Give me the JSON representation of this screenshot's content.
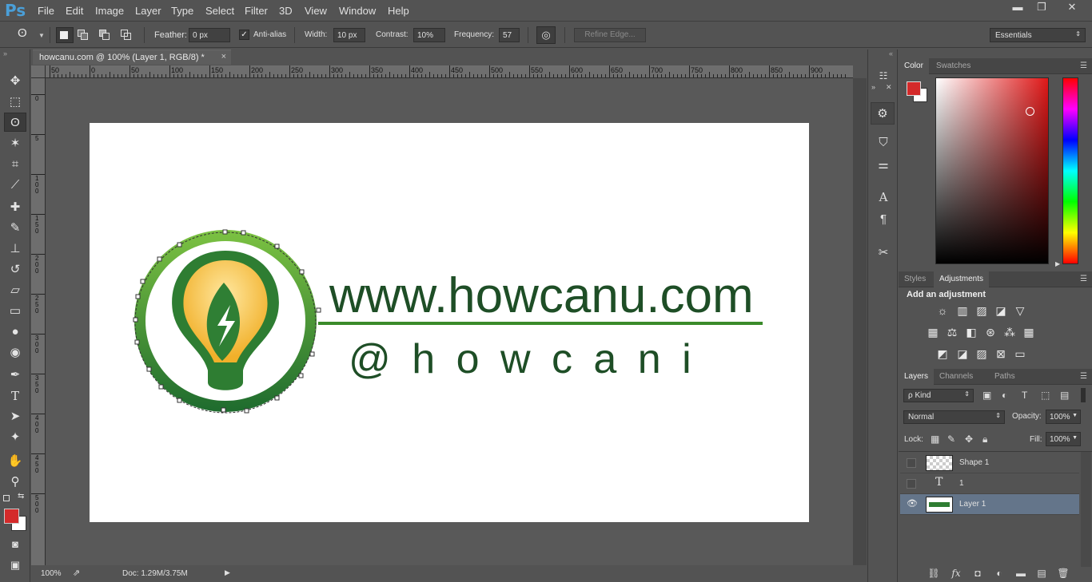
{
  "app": {
    "logo": "Ps"
  },
  "menu": [
    "File",
    "Edit",
    "Image",
    "Layer",
    "Type",
    "Select",
    "Filter",
    "3D",
    "View",
    "Window",
    "Help"
  ],
  "window_controls": {
    "minimize": "▬",
    "restore": "❐",
    "close": "✕"
  },
  "options": {
    "feather_label": "Feather:",
    "feather_value": "0 px",
    "antialias_label": "Anti-alias",
    "width_label": "Width:",
    "width_value": "10 px",
    "contrast_label": "Contrast:",
    "contrast_value": "10%",
    "frequency_label": "Frequency:",
    "frequency_value": "57",
    "refine_edge": "Refine Edge...",
    "workspace": "Essentials"
  },
  "document": {
    "tab_title": "howcanu.com @ 100% (Layer 1, RGB/8) *",
    "tab_close": "×",
    "ruler_h_labels": [
      "50",
      "0",
      "50",
      "100",
      "150",
      "200",
      "250",
      "300",
      "350",
      "400",
      "450",
      "500",
      "550",
      "600",
      "650",
      "700",
      "750",
      "800",
      "850",
      "900"
    ],
    "ruler_v_labels": [
      "0",
      "5",
      "1\n0\n0",
      "1\n5\n0",
      "2\n0\n0",
      "2\n5\n0",
      "3\n0\n0",
      "3\n5\n0",
      "4\n0\n0",
      "4\n5\n0",
      "5\n0\n0"
    ],
    "logo_line1": "www.howcanu.com",
    "logo_line2": "@ h o w c a n i"
  },
  "status": {
    "zoom": "100%",
    "doc": "Doc: 1.29M/3.75M"
  },
  "panels": {
    "color_tabs": [
      "Color",
      "Swatches"
    ],
    "style_tabs": [
      "Styles",
      "Adjustments"
    ],
    "add_adjustment": "Add an adjustment",
    "layer_tabs": [
      "Layers",
      "Channels",
      "Paths"
    ],
    "kind": "ρ Kind",
    "blend_mode": "Normal",
    "opacity_label": "Opacity:",
    "opacity_value": "100%",
    "lock_label": "Lock:",
    "fill_label": "Fill:",
    "fill_value": "100%",
    "layers": [
      {
        "name": "Shape 1",
        "visible": false
      },
      {
        "name": "1",
        "visible": false
      },
      {
        "name": "Layer 1",
        "visible": true
      }
    ]
  },
  "colors": {
    "foreground": "#d42a2a",
    "background": "#ffffff",
    "logo_green": "#1e5a2a",
    "ring_green": "#5aa833"
  }
}
